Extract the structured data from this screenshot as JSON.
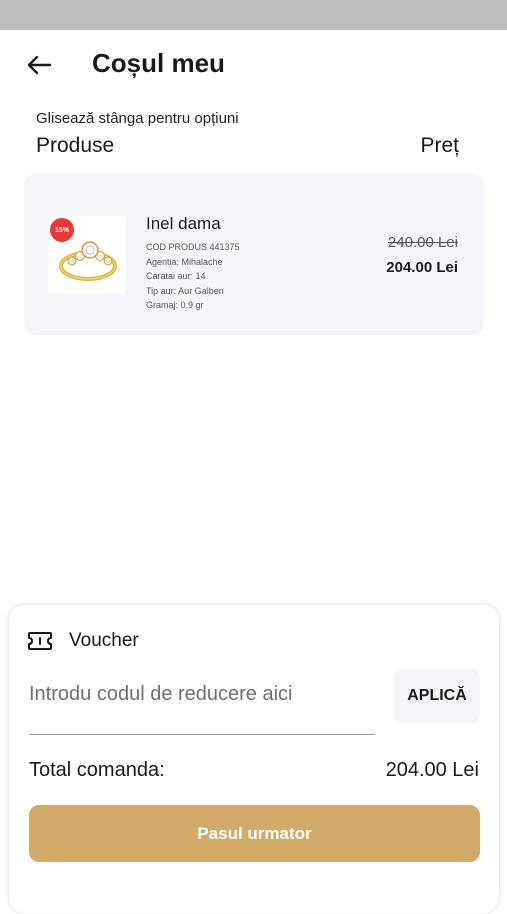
{
  "header": {
    "back_icon": "arrow-left-icon",
    "title": "Coșul meu"
  },
  "cart": {
    "hint": "Glisează stânga pentru opțiuni",
    "col_products": "Produse",
    "col_price": "Preț",
    "items": [
      {
        "badge": "15%",
        "name": "Inel dama",
        "details": [
          "COD PRODUS 441375",
          "Agentia: Mihalache",
          "Caratai aur: 14",
          "Tip aur: Aur Galben",
          "Gramaj: 0.9 gr"
        ],
        "old_price": "240.00 Lei",
        "new_price": "204.00 Lei",
        "image_icon": "gold-ring-icon"
      }
    ]
  },
  "checkout": {
    "voucher_icon": "ticket-icon",
    "voucher_label": "Voucher",
    "voucher_placeholder": "Introdu codul de reducere aici",
    "voucher_value": "",
    "apply_label": "APLICĂ",
    "total_label": "Total comanda:",
    "total_value": "204.00 Lei",
    "next_label": "Pasul urmator"
  },
  "colors": {
    "accent": "#d2ab6a",
    "badge": "#e53935",
    "card_bg": "#f5f6fa",
    "status_bar": "#bdbdbd"
  }
}
